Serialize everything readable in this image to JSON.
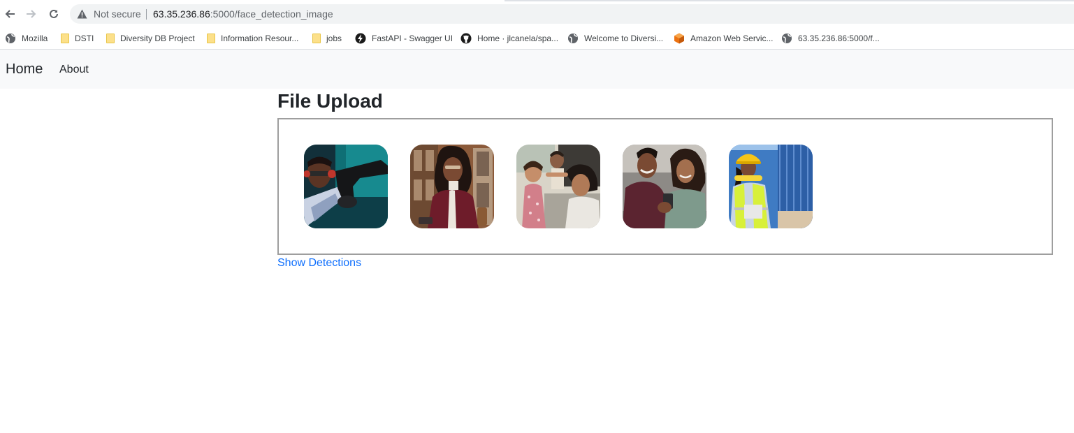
{
  "browser": {
    "security_label": "Not secure",
    "url_host": "63.35.236.86",
    "url_path": ":5000/face_detection_image",
    "bookmarks": [
      {
        "label": "Mozilla",
        "icon": "globe-icon"
      },
      {
        "label": "DSTI",
        "icon": "folder-icon"
      },
      {
        "label": "Diversity DB Project",
        "icon": "folder-icon"
      },
      {
        "label": "Information Resour...",
        "icon": "folder-icon"
      },
      {
        "label": "jobs",
        "icon": "folder-icon"
      },
      {
        "label": "FastAPI - Swagger UI",
        "icon": "bolt-icon"
      },
      {
        "label": "Home · jlcanela/spa...",
        "icon": "github-icon"
      },
      {
        "label": "Welcome to Diversi...",
        "icon": "globe-icon"
      },
      {
        "label": "Amazon Web Servic...",
        "icon": "aws-cube-icon"
      },
      {
        "label": "63.35.236.86:5000/f...",
        "icon": "globe-icon"
      }
    ]
  },
  "navbar": {
    "brand": "Home",
    "links": [
      "About"
    ]
  },
  "main": {
    "title": "File Upload",
    "images": [
      {
        "name": "image-1",
        "description_icon": "photo-icon"
      },
      {
        "name": "image-2",
        "description_icon": "photo-icon"
      },
      {
        "name": "image-3",
        "description_icon": "photo-icon"
      },
      {
        "name": "image-4",
        "description_icon": "photo-icon"
      },
      {
        "name": "image-5",
        "description_icon": "photo-icon"
      }
    ],
    "show_detections_label": "Show Detections"
  },
  "colors": {
    "link": "#0d6efd",
    "navbar_bg": "#f8f9fa",
    "upload_border": "#9e9e9e"
  }
}
